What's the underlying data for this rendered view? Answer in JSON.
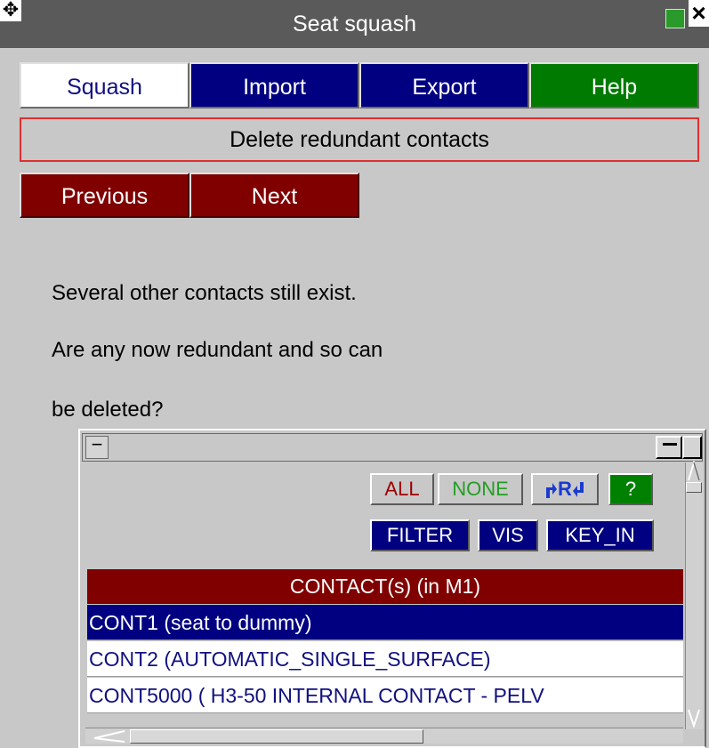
{
  "window": {
    "title": "Seat squash"
  },
  "tabs": [
    {
      "label": "Squash"
    },
    {
      "label": "Import"
    },
    {
      "label": "Export"
    },
    {
      "label": "Help"
    }
  ],
  "step": {
    "title": "Delete redundant contacts"
  },
  "nav": {
    "previous_label": "Previous",
    "next_label": "Next"
  },
  "message": {
    "line1": "Several other contacts still exist.",
    "line2": "Are any now redundant and so can",
    "line3": "be deleted?"
  },
  "list_controls": {
    "all_label": "ALL",
    "none_label": "NONE",
    "reverse_label": "R",
    "help_label": "?",
    "filter_label": "FILTER",
    "vis_label": "VIS",
    "keyin_label": "KEY_IN"
  },
  "list": {
    "header": "CONTACT(s) (in M1)",
    "rows": [
      {
        "label": "CONT1 (seat to dummy)",
        "selected": true
      },
      {
        "label": "CONT2 (AUTOMATIC_SINGLE_SURFACE)",
        "selected": false
      },
      {
        "label": "CONT5000 ( H3-50 INTERNAL CONTACT - PELV",
        "selected": false
      }
    ]
  },
  "colors": {
    "tab_active_bg": "#ffffff",
    "tab_bg": "#000080",
    "help_bg": "#007a00",
    "nav_bg": "#800000",
    "step_border": "#e03030",
    "selected_row_bg": "#000080"
  }
}
